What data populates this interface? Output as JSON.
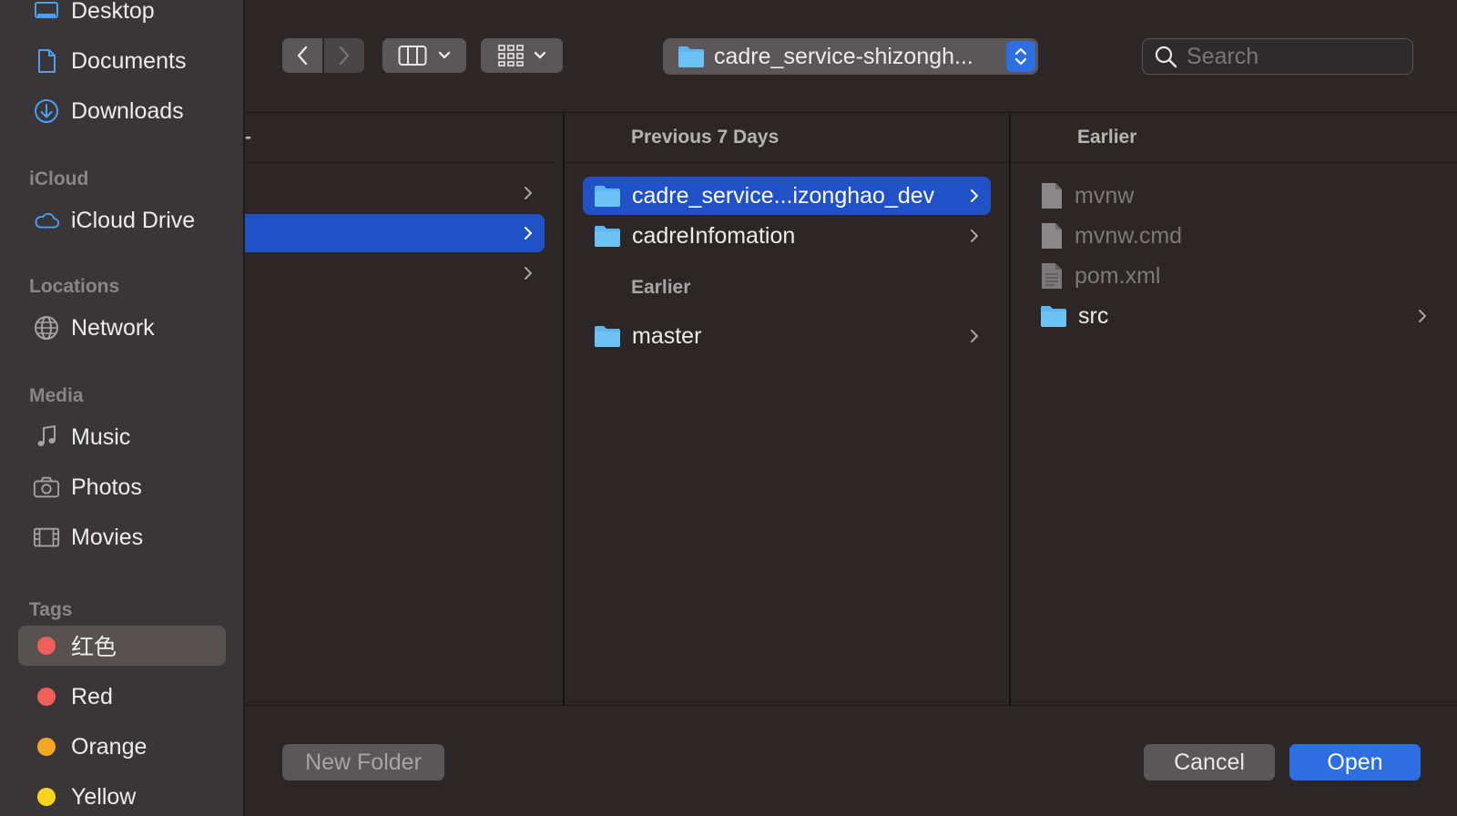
{
  "sidebar": {
    "favorites": [
      {
        "label": "Desktop",
        "icon": "desktop-icon"
      },
      {
        "label": "Documents",
        "icon": "document-icon"
      },
      {
        "label": "Downloads",
        "icon": "download-icon"
      }
    ],
    "icloud_heading": "iCloud",
    "icloud": [
      {
        "label": "iCloud Drive",
        "icon": "cloud-icon"
      }
    ],
    "locations_heading": "Locations",
    "locations": [
      {
        "label": "Network",
        "icon": "globe-icon"
      }
    ],
    "media_heading": "Media",
    "media": [
      {
        "label": "Music",
        "icon": "music-note-icon"
      },
      {
        "label": "Photos",
        "icon": "camera-icon"
      },
      {
        "label": "Movies",
        "icon": "film-icon"
      }
    ],
    "tags_heading": "Tags",
    "tags": [
      {
        "label": "红色",
        "color": "#f0605a"
      },
      {
        "label": "Red",
        "color": "#f0605a"
      },
      {
        "label": "Orange",
        "color": "#f5a623"
      },
      {
        "label": "Yellow",
        "color": "#f7d51d"
      }
    ]
  },
  "toolbar": {
    "path_label": "cadre_service-shizongh...",
    "search_placeholder": "Search"
  },
  "columns": {
    "col1": {
      "header_fragment": "-"
    },
    "col2": {
      "header": "Previous 7 Days",
      "items_recent": [
        {
          "name": "cadre_service...izonghao_dev",
          "selected": true
        },
        {
          "name": "cadreInfomation",
          "selected": false
        }
      ],
      "earlier_heading": "Earlier",
      "items_earlier": [
        {
          "name": "master",
          "selected": false
        }
      ]
    },
    "col3": {
      "header": "Earlier",
      "items": [
        {
          "name": "mvnw",
          "kind": "file"
        },
        {
          "name": "mvnw.cmd",
          "kind": "file"
        },
        {
          "name": "pom.xml",
          "kind": "xml"
        },
        {
          "name": "src",
          "kind": "folder"
        }
      ]
    }
  },
  "buttons": {
    "new_folder": "New Folder",
    "cancel": "Cancel",
    "open": "Open"
  },
  "colors": {
    "accent": "#2d6fe3",
    "selection": "#2151c6",
    "folder": "#5fb5ef"
  }
}
